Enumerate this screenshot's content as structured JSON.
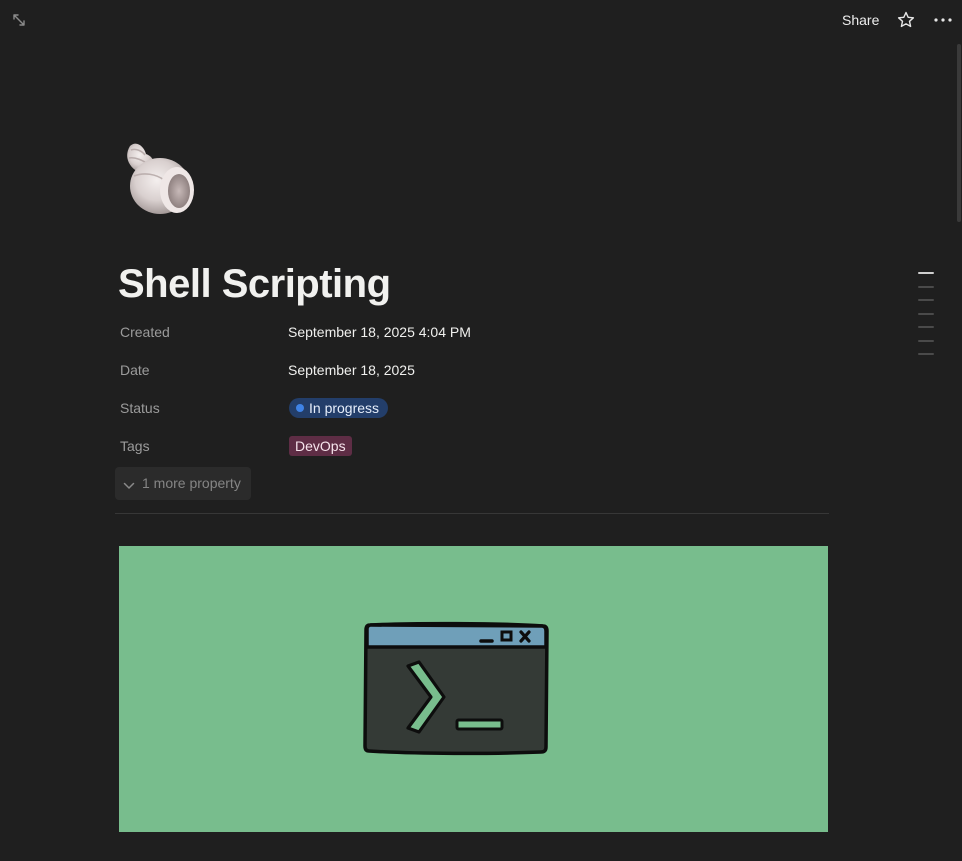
{
  "topbar": {
    "expand_icon": "expand-diagonal-icon",
    "share_label": "Share",
    "star_icon": "star-outline-icon",
    "more_icon": "more-horizontal-icon"
  },
  "page": {
    "icon": "spiral-shell-emoji",
    "title": "Shell Scripting"
  },
  "properties": [
    {
      "label": "Created",
      "value": "September 18, 2025 4:04 PM"
    },
    {
      "label": "Date",
      "value": "September 18, 2025"
    },
    {
      "label": "Status",
      "value": "In progress"
    },
    {
      "label": "Tags",
      "value": "DevOps"
    }
  ],
  "more_properties_label": "1 more property",
  "status_color": "#3f83e6",
  "tag_color": "#5e2d45",
  "cover": {
    "image": "terminal-window-illustration",
    "background": "#78bd8d"
  },
  "toc_count": 7
}
